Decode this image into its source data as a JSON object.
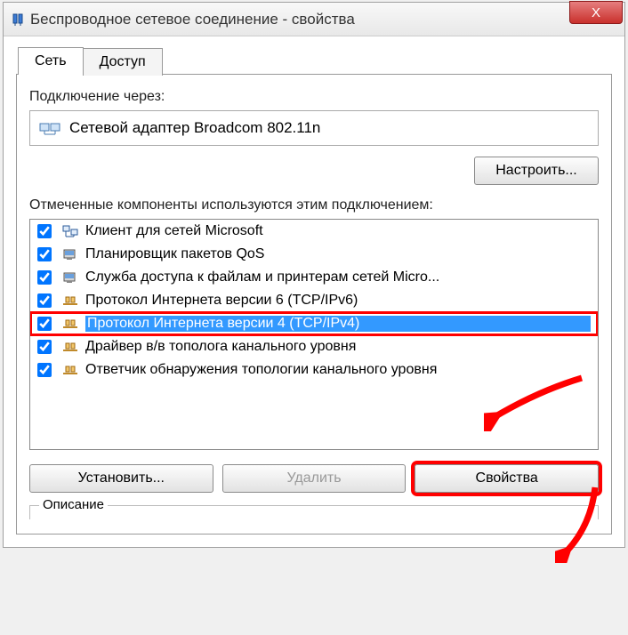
{
  "titlebar": {
    "title": "Беспроводное сетевое соединение - свойства",
    "close_label": "X"
  },
  "tabs": {
    "network": "Сеть",
    "access": "Доступ"
  },
  "connect_via_label": "Подключение через:",
  "adapter_name": "Сетевой адаптер Broadcom 802.11n",
  "configure_label": "Настроить...",
  "components_label": "Отмеченные компоненты используются этим подключением:",
  "components": [
    {
      "label": "Клиент для сетей Microsoft",
      "checked": true,
      "icon": "client"
    },
    {
      "label": "Планировщик пакетов QoS",
      "checked": true,
      "icon": "service"
    },
    {
      "label": "Служба доступа к файлам и принтерам сетей Micro...",
      "checked": true,
      "icon": "service"
    },
    {
      "label": "Протокол Интернета версии 6 (TCP/IPv6)",
      "checked": true,
      "icon": "protocol"
    },
    {
      "label": "Протокол Интернета версии 4 (TCP/IPv4)",
      "checked": true,
      "icon": "protocol",
      "selected": true
    },
    {
      "label": "Драйвер в/в тополога канального уровня",
      "checked": true,
      "icon": "protocol"
    },
    {
      "label": "Ответчик обнаружения топологии канального уровня",
      "checked": true,
      "icon": "protocol"
    }
  ],
  "buttons": {
    "install": "Установить...",
    "remove": "Удалить",
    "properties": "Свойства"
  },
  "description_label": "Описание"
}
